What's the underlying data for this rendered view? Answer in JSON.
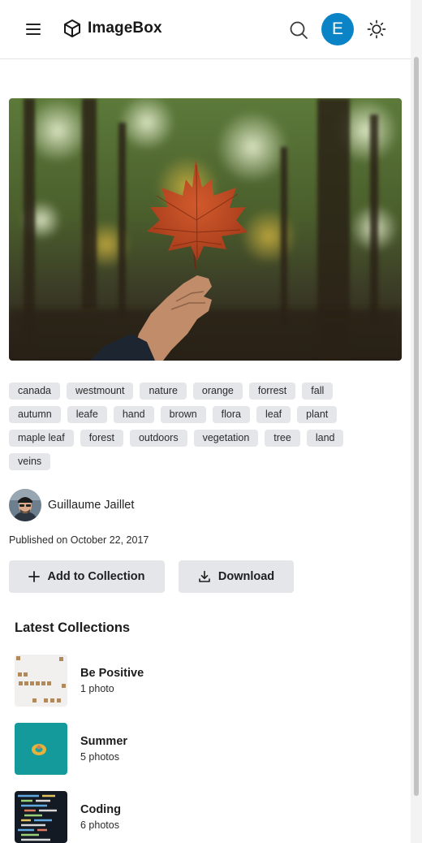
{
  "header": {
    "app_name": "ImageBox",
    "avatar_initial": "E",
    "avatar_color": "#0a84c6",
    "icons": [
      "menu-icon",
      "cube-logo-icon",
      "search-icon",
      "sun-icon"
    ]
  },
  "photo": {
    "subject": "hand holding a red maple leaf in an autumn forest",
    "tags": [
      "canada",
      "westmount",
      "nature",
      "orange",
      "forrest",
      "fall",
      "autumn",
      "leafe",
      "hand",
      "brown",
      "flora",
      "leaf",
      "plant",
      "maple leaf",
      "forest",
      "outdoors",
      "vegetation",
      "tree",
      "land",
      "veins"
    ],
    "author": "Guillaume Jaillet",
    "published": "Published on October 22, 2017"
  },
  "actions": {
    "add_label": "Add to Collection",
    "download_label": "Download"
  },
  "collections": {
    "title": "Latest Collections",
    "items": [
      {
        "name": "Be Positive",
        "count": "1 photo"
      },
      {
        "name": "Summer",
        "count": "5 photos"
      },
      {
        "name": "Coding",
        "count": "6 photos"
      }
    ]
  }
}
